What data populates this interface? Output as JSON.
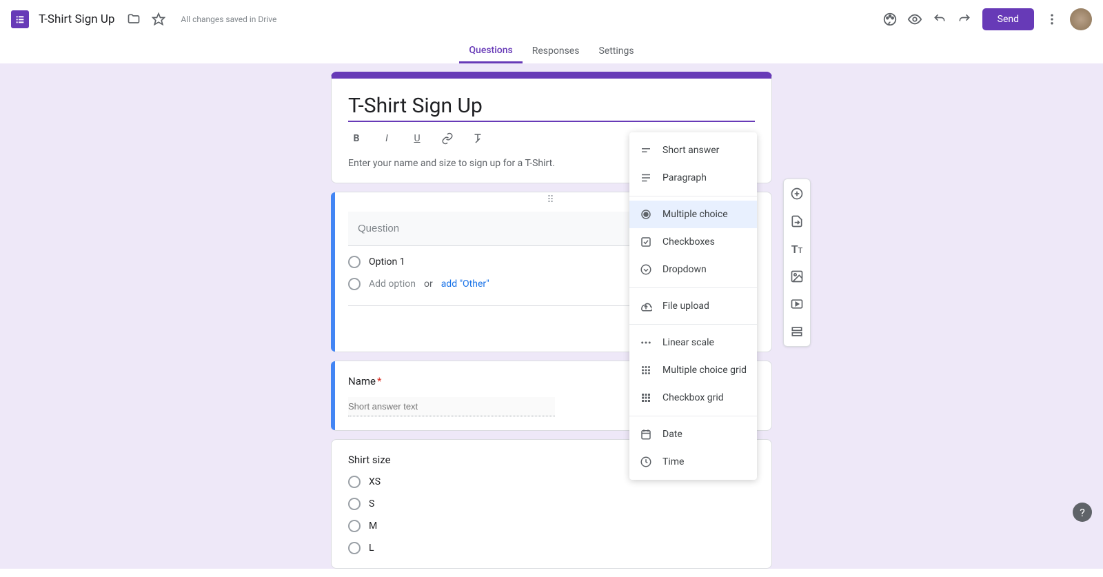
{
  "header": {
    "doc_title": "T-Shirt Sign Up",
    "save_status": "All changes saved in Drive",
    "send_label": "Send"
  },
  "tabs": {
    "questions": "Questions",
    "responses": "Responses",
    "settings": "Settings"
  },
  "form": {
    "title": "T-Shirt Sign Up",
    "description": "Enter your name and size to sign up for a T-Shirt."
  },
  "question_editor": {
    "placeholder": "Question",
    "option1": "Option 1",
    "add_option": "Add option",
    "or": "or",
    "add_other": "add \"Other\""
  },
  "name_q": {
    "label": "Name",
    "required": "*",
    "placeholder": "Short answer text"
  },
  "size_q": {
    "label": "Shirt size",
    "options": [
      "XS",
      "S",
      "M",
      "L"
    ]
  },
  "type_menu": {
    "short_answer": "Short answer",
    "paragraph": "Paragraph",
    "multiple_choice": "Multiple choice",
    "checkboxes": "Checkboxes",
    "dropdown": "Dropdown",
    "file_upload": "File upload",
    "linear_scale": "Linear scale",
    "mc_grid": "Multiple choice grid",
    "cb_grid": "Checkbox grid",
    "date": "Date",
    "time": "Time"
  }
}
